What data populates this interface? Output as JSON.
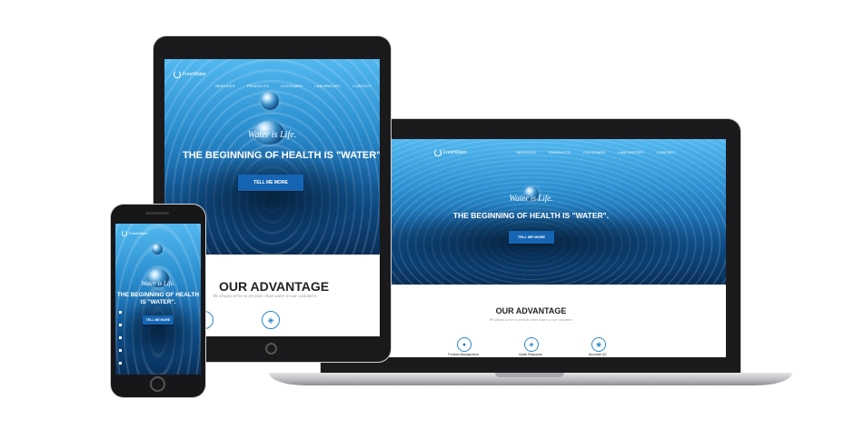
{
  "site": {
    "logo_text": "FreshWater",
    "nav": [
      "SERVICES",
      "PRODUCTS",
      "CUSTOMER",
      "LABORATORY",
      "CONTACT"
    ],
    "tagline": "Water is Life.",
    "headline": "THE BEGINNING OF HEALTH IS \"WATER\".",
    "headline_phone_line1": "THE BEGINNING OF HEALTH",
    "headline_phone_line2": "IS \"WATER\".",
    "cta": "TELL ME MORE",
    "advantage_title": "OUR ADVANTAGE",
    "advantage_subtitle": "We always strive to provide clean water to our customers",
    "features": [
      "Product Management",
      "Quick Response",
      "Accurate QC"
    ]
  },
  "colors": {
    "accent": "#1565b4",
    "sky": "#52b8ef",
    "deep": "#082e57"
  }
}
